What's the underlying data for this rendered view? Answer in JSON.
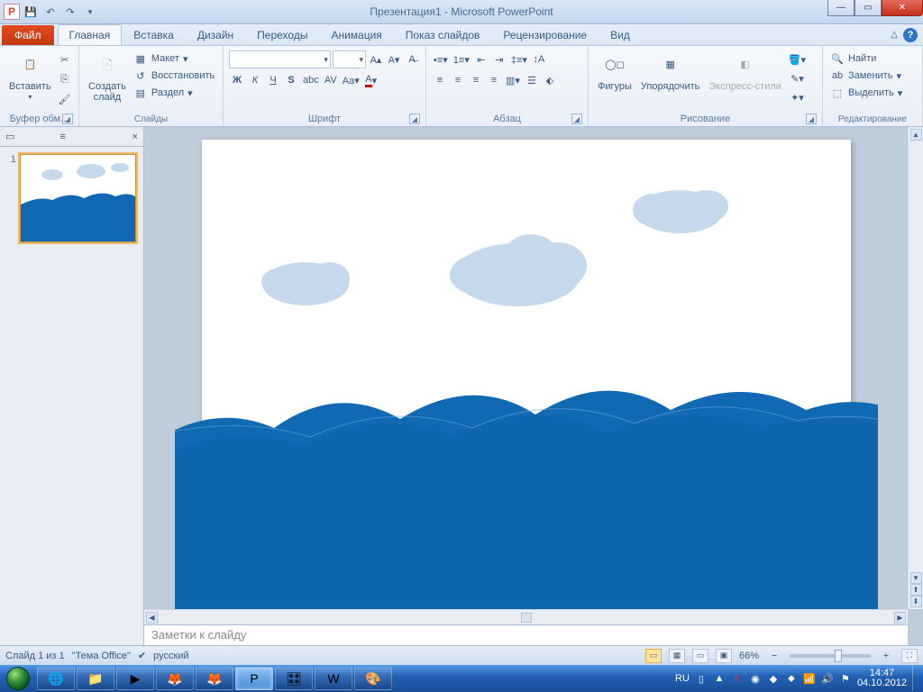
{
  "title": "Презентация1 - Microsoft PowerPoint",
  "app_letter": "P",
  "tabs": {
    "file": "Файл",
    "home": "Главная",
    "insert": "Вставка",
    "design": "Дизайн",
    "transitions": "Переходы",
    "animations": "Анимация",
    "slideshow": "Показ слайдов",
    "review": "Рецензирование",
    "view": "Вид"
  },
  "groups": {
    "clipboard": "Буфер обм...",
    "slides": "Слайды",
    "font": "Шрифт",
    "paragraph": "Абзац",
    "drawing": "Рисование",
    "editing": "Редактирование"
  },
  "buttons": {
    "paste": "Вставить",
    "newslide": "Создать\nслайд",
    "layout": "Макет",
    "reset": "Восстановить",
    "section": "Раздел",
    "shapes": "Фигуры",
    "arrange": "Упорядочить",
    "quickstyles": "Экспресс-стили",
    "find": "Найти",
    "replace": "Заменить",
    "select": "Выделить"
  },
  "panel": {
    "outline_icon": "≡",
    "close": "×",
    "slide_num": "1"
  },
  "notes_placeholder": "Заметки к слайду",
  "status": {
    "slide": "Слайд 1 из 1",
    "theme": "\"Тема Office\"",
    "lang": "русский",
    "zoom": "66%"
  },
  "tray": {
    "lang": "RU",
    "time": "14:47",
    "date": "04.10.2012"
  }
}
